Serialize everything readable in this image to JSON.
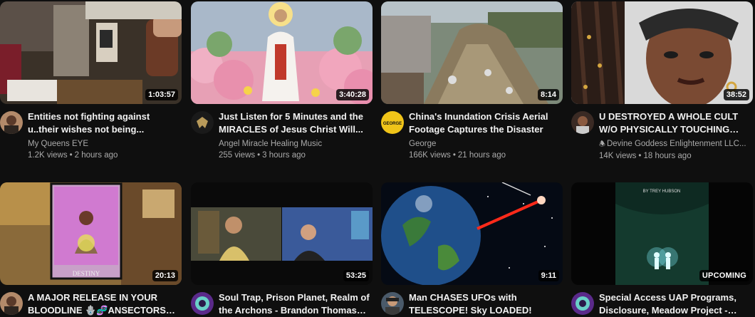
{
  "videos": [
    {
      "title": "Entities not fighting against u..their wishes not being...",
      "channel": "My Queens EYE",
      "views": "1.2K views",
      "age": "2 hours ago",
      "duration": "1:03:57"
    },
    {
      "title": "Just Listen for 5 Minutes and the MIRACLES of Jesus Christ Will...",
      "channel": "Angel Miracle Healing Music",
      "views": "255 views",
      "age": "3 hours ago",
      "duration": "3:40:28"
    },
    {
      "title": "China's Inundation Crisis Aerial Footage Captures the Disaster",
      "channel": "George",
      "views": "166K views",
      "age": "21 hours ago",
      "duration": "8:14",
      "avatar_text": "GEORGE"
    },
    {
      "title": "U DESTROYED A WHOLE CULT W/O PHYSICALLY TOUCHING EM...",
      "channel_icon": "🕭",
      "channel": "Devine Goddess Enlightenment LLC...",
      "views": "14K views",
      "age": "18 hours ago",
      "duration": "38:52"
    },
    {
      "title": "A MAJOR RELEASE IN YOUR BLOODLINE 🪬🧬ANSECTORS R...",
      "duration": "20:13",
      "thumb_text": "DESTINY"
    },
    {
      "title": "Soul Trap, Prison Planet, Realm of the Archons - Brandon Thomas o...",
      "duration": "53:25"
    },
    {
      "title": "Man CHASES UFOs with TELESCOPE! Sky LOADED!",
      "duration": "9:11"
    },
    {
      "title": "Special Access UAP Programs, Disclosure, Meadow Project - Tre...",
      "duration": "UPCOMING",
      "thumb_text1": "BY TREY HUBSON"
    }
  ],
  "separator": "•"
}
